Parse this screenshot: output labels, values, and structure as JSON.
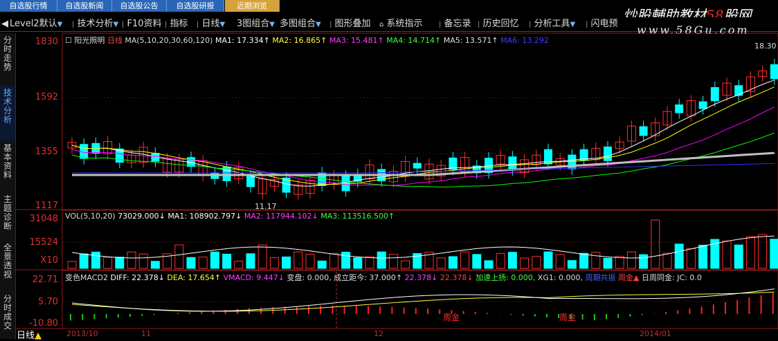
{
  "top_tabs": [
    {
      "label": "自选股行情",
      "hl": false
    },
    {
      "label": "自选股新闻",
      "hl": false
    },
    {
      "label": "自选股公告",
      "hl": false
    },
    {
      "label": "自选股研报",
      "hl": false
    },
    {
      "label": "近期浏览",
      "hl": true
    }
  ],
  "brand": {
    "logo_text": "炒股輔助教材",
    "logo_red": "58",
    "logo_tail": "股网",
    "url": "www.58Gu.com"
  },
  "menu": [
    {
      "label": "Level2默认",
      "arrow": true
    },
    {
      "label": "技术分析",
      "arrow": true
    },
    {
      "label": "F10资料",
      "arrow": false
    },
    {
      "label": "指标",
      "arrow": false
    },
    {
      "label": "日线",
      "arrow": true
    },
    {
      "label": "3图组合",
      "arrow": true
    },
    {
      "label": "多图组合",
      "arrow": true
    },
    {
      "label": "图形叠加",
      "arrow": false
    },
    {
      "label": "系统指示",
      "arrow": false
    },
    {
      "label": "备忘录",
      "arrow": false
    },
    {
      "label": "历史回忆",
      "arrow": false
    },
    {
      "label": "分析工具",
      "arrow": true
    },
    {
      "label": "闪电预",
      "arrow": false
    }
  ],
  "sidebar": [
    {
      "label": "分时走势"
    },
    {
      "label": "技术分析"
    },
    {
      "label": "基本资料"
    },
    {
      "label": "主题诊断"
    },
    {
      "label": "全景透视"
    },
    {
      "label": "分时成交"
    }
  ],
  "main_chart": {
    "stock_name": "阳光照明",
    "period": "日线",
    "ma_params": "MA(5,10,20,30,60,120)",
    "ma1": "MA1: 17.334↑",
    "ma2": "MA2: 16.865↑",
    "ma3": "MA3: 15.481↑",
    "ma4": "MA4: 14.714↑",
    "ma5": "MA5: 13.571↑",
    "ma6": "MA6: 13.292",
    "y_ticks": [
      "1830",
      "1592",
      "1355",
      "1117"
    ],
    "high_label": "18.30",
    "low_label": "11.17",
    "colors": {
      "ma1": "#ffffff",
      "ma2": "#ffff00",
      "ma3": "#ff00ff",
      "ma4": "#00ff00",
      "ma5": "#c0c0c0",
      "ma6": "#3030ff",
      "up": "#ff3030",
      "down": "#00ffff"
    }
  },
  "vol_chart": {
    "params": "VOL(5,10,20)",
    "vol": "73029.000↓",
    "ma1": "MA1: 108902.797↓",
    "ma2": "MA2: 117944.102↓",
    "ma3": "MA3: 113516.500↑",
    "y_ticks": [
      "31048",
      "15524",
      "X10"
    ]
  },
  "macd_chart": {
    "name": "变色MACD2",
    "diff": "DIFF: 22.378↓",
    "dea": "DEA: 17.654↑",
    "vmacd": "VMACD: 9.447↓",
    "bianpan": "变盘: 0.000,",
    "chengjiao": "成立距今: 37.000↑",
    "v1": "22.378↓",
    "v2": "22.378↓",
    "accel": "加速上扬: 0.000,",
    "xg1": "XG1: 0.000,",
    "extra": "周期共振",
    "zhoujin": "周金▲",
    "rizhou": "日周同金: JC: 0.0",
    "y_ticks": [
      "22.71",
      "5.70",
      "-10.80"
    ],
    "zhoujin_marks": [
      "周金",
      "周金"
    ]
  },
  "bottom": {
    "period_label": "日线",
    "dates": [
      "2013/10",
      "11",
      "12",
      "2014/01"
    ]
  }
}
